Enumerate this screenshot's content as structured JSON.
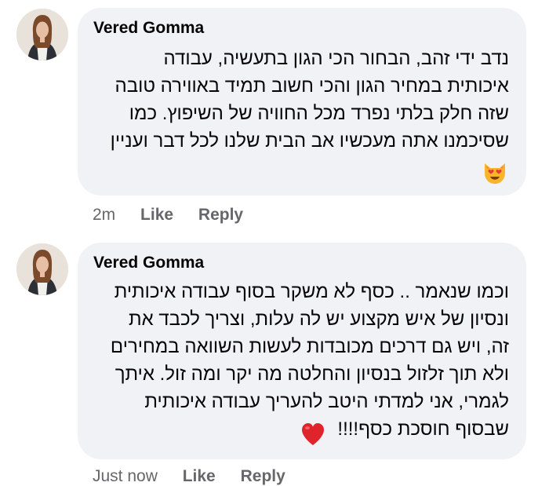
{
  "comments": [
    {
      "author": "Vered Gomma",
      "lines": [
        "נדב ידי זהב, הבחור הכי הגון בתעשיה, עבודה",
        "איכותית במחיר הגון והכי חשוב תמיד באווירה טובה",
        "שזה חלק בלתי נפרד מכל החוויה של השיפוץ. כמו",
        "שסיכמנו אתה מעכשיו אב הבית שלנו לכל דבר ועניין"
      ],
      "emoji": "smiling-cat-heart-eyes",
      "time": "2m",
      "like": "Like",
      "reply": "Reply"
    },
    {
      "author": "Vered Gomma",
      "lines": [
        "וכמו שנאמר .. כסף לא משקר בסוף עבודה איכותית",
        "ונסיון של איש מקצוע יש לה עלות, וצריך לכבד את",
        "זה, ויש גם דרכים מכובדות לעשות השוואה במחירים",
        "ולא תוך זלזול בנסיון והחלטה מה יקר ומה זול. איתך",
        "לגמרי, אני למדתי היטב להעריך עבודה איכותית",
        "שבסוף חוסכת כסף!!!!"
      ],
      "emoji": "red-heart",
      "time": "Just now",
      "like": "Like",
      "reply": "Reply"
    }
  ]
}
